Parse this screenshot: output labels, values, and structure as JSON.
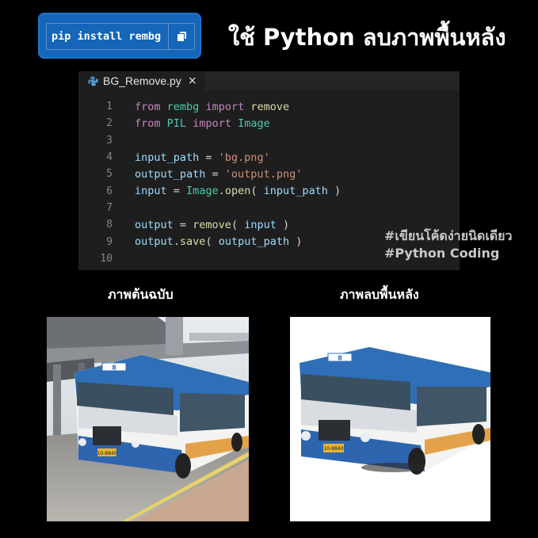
{
  "install": {
    "command": "pip install rembg",
    "copy_icon": "copy-icon"
  },
  "title": "ใช้ Python ลบภาพพื้นหลัง",
  "editor": {
    "tab": {
      "filename": "BG_Remove.py",
      "close": "×",
      "icon": "python-file-icon"
    },
    "lines": [
      {
        "n": "1"
      },
      {
        "n": "2"
      },
      {
        "n": "3"
      },
      {
        "n": "4"
      },
      {
        "n": "5"
      },
      {
        "n": "6"
      },
      {
        "n": "7"
      },
      {
        "n": "8"
      },
      {
        "n": "9"
      },
      {
        "n": "10"
      }
    ],
    "code": {
      "l1": [
        "from",
        "rembg",
        "import",
        "remove"
      ],
      "l2": [
        "from",
        "PIL",
        "import",
        "Image"
      ],
      "l4": [
        "input_path",
        " = ",
        "'bg.png'"
      ],
      "l5": [
        "output_path",
        " = ",
        "'output.png'"
      ],
      "l6": [
        "input",
        " = ",
        "Image",
        ".",
        "open",
        "( ",
        "input_path",
        " )"
      ],
      "l8": [
        "output",
        " = ",
        "remove",
        "( ",
        "input",
        " )"
      ],
      "l9": [
        "output",
        ".",
        "save",
        "( ",
        "output_path",
        " )"
      ]
    }
  },
  "hashtags": [
    "#เขียนโค้ดง่ายนิดเดียว",
    "#Python Coding"
  ],
  "captions": {
    "original": "ภาพต้นฉบับ",
    "removed": "ภาพลบพื้นหลัง"
  },
  "bus": {
    "route": "8",
    "plate": "10-8840"
  },
  "colors": {
    "pill": "#1565b8",
    "editor_bg": "#1e1e1e",
    "keyword": "#c586c0",
    "string": "#ce9178",
    "variable": "#9cdcfe",
    "function": "#dcdcaa",
    "class": "#4ec9b0"
  }
}
